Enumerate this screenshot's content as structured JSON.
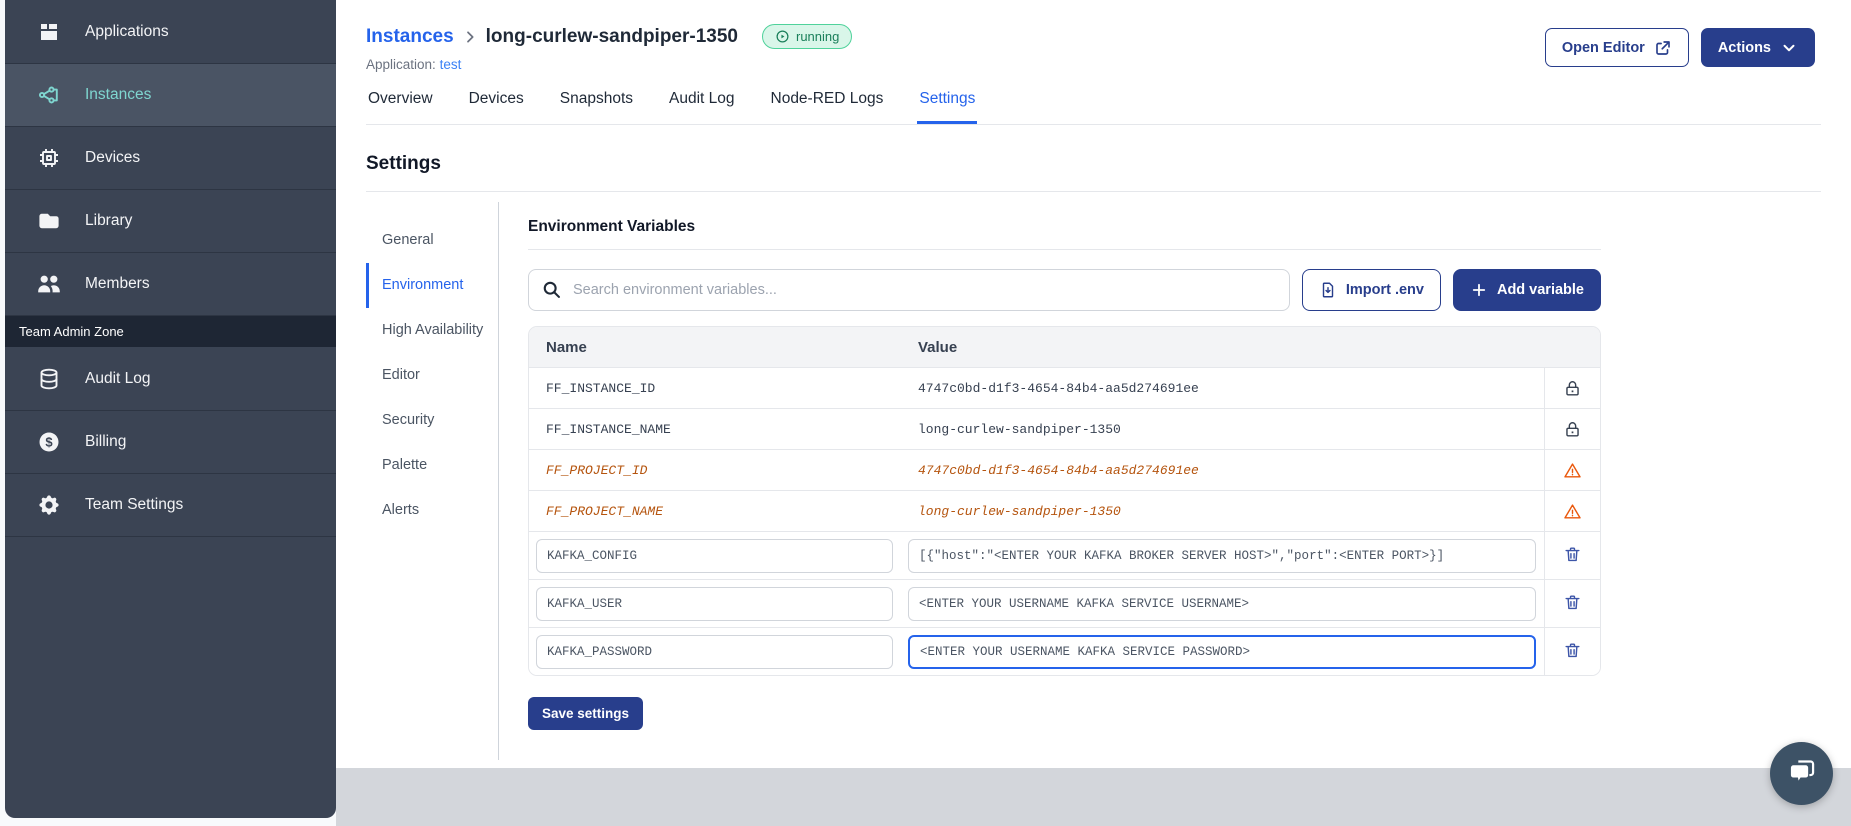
{
  "colors": {
    "sidebar_bg": "#3b4454",
    "sidebar_active_bg": "#4a5464",
    "sidebar_active_teal": "#7fd6d0",
    "accent_navy": "#283e8c",
    "link_blue": "#2563eb",
    "running_badge_bg": "#d9f6e9",
    "running_badge_border": "#4fd29b",
    "running_badge_text": "#1a7f5a",
    "deprecated_orange": "#b5540e",
    "warning_icon_orange": "#ea580c",
    "trash_icon_blue": "#3d55a8",
    "footer_strip_gray": "#d3d6db",
    "chat_fab_slate": "#3d5266"
  },
  "sidebar": {
    "items": [
      {
        "label": "Applications",
        "icon": "applications-icon",
        "active": false
      },
      {
        "label": "Instances",
        "icon": "instances-icon",
        "active": true
      },
      {
        "label": "Devices",
        "icon": "devices-icon",
        "active": false
      },
      {
        "label": "Library",
        "icon": "library-icon",
        "active": false
      },
      {
        "label": "Members",
        "icon": "members-icon",
        "active": false
      }
    ],
    "section_label": "Team Admin Zone",
    "admin_items": [
      {
        "label": "Audit Log",
        "icon": "audit-log-icon",
        "active": false
      },
      {
        "label": "Billing",
        "icon": "billing-icon",
        "active": false
      },
      {
        "label": "Team Settings",
        "icon": "team-settings-icon",
        "active": false
      }
    ]
  },
  "header": {
    "breadcrumb_root": "Instances",
    "instance_name": "long-curlew-sandpiper-1350",
    "status": "running",
    "application_label": "Application:",
    "application_name": "test",
    "open_editor_label": "Open Editor",
    "actions_label": "Actions"
  },
  "tabs": [
    {
      "label": "Overview",
      "active": false
    },
    {
      "label": "Devices",
      "active": false
    },
    {
      "label": "Snapshots",
      "active": false
    },
    {
      "label": "Audit Log",
      "active": false
    },
    {
      "label": "Node-RED Logs",
      "active": false
    },
    {
      "label": "Settings",
      "active": true
    }
  ],
  "settings": {
    "title": "Settings",
    "nav": [
      {
        "label": "General",
        "active": false
      },
      {
        "label": "Environment",
        "active": true
      },
      {
        "label": "High Availability",
        "active": false
      },
      {
        "label": "Editor",
        "active": false
      },
      {
        "label": "Security",
        "active": false
      },
      {
        "label": "Palette",
        "active": false
      },
      {
        "label": "Alerts",
        "active": false
      }
    ]
  },
  "env": {
    "title": "Environment Variables",
    "search_placeholder": "Search environment variables...",
    "import_label": "Import .env",
    "add_label": "Add variable",
    "columns": {
      "name": "Name",
      "value": "Value"
    },
    "rows": [
      {
        "name": "FF_INSTANCE_ID",
        "value": "4747c0bd-d1f3-4654-84b4-aa5d274691ee",
        "kind": "locked"
      },
      {
        "name": "FF_INSTANCE_NAME",
        "value": "long-curlew-sandpiper-1350",
        "kind": "locked"
      },
      {
        "name": "FF_PROJECT_ID",
        "value": "4747c0bd-d1f3-4654-84b4-aa5d274691ee",
        "kind": "deprecated"
      },
      {
        "name": "FF_PROJECT_NAME",
        "value": "long-curlew-sandpiper-1350",
        "kind": "deprecated"
      },
      {
        "name": "KAFKA_CONFIG",
        "value": "[{\"host\":\"<ENTER YOUR KAFKA BROKER SERVER HOST>\",\"port\":<ENTER PORT>}]",
        "kind": "editable",
        "focused": false
      },
      {
        "name": "KAFKA_USER",
        "value": "<ENTER YOUR USERNAME KAFKA SERVICE USERNAME>",
        "kind": "editable",
        "focused": false
      },
      {
        "name": "KAFKA_PASSWORD",
        "value": "<ENTER YOUR USERNAME KAFKA SERVICE PASSWORD>",
        "kind": "editable",
        "focused": true
      }
    ],
    "save_label": "Save settings"
  }
}
